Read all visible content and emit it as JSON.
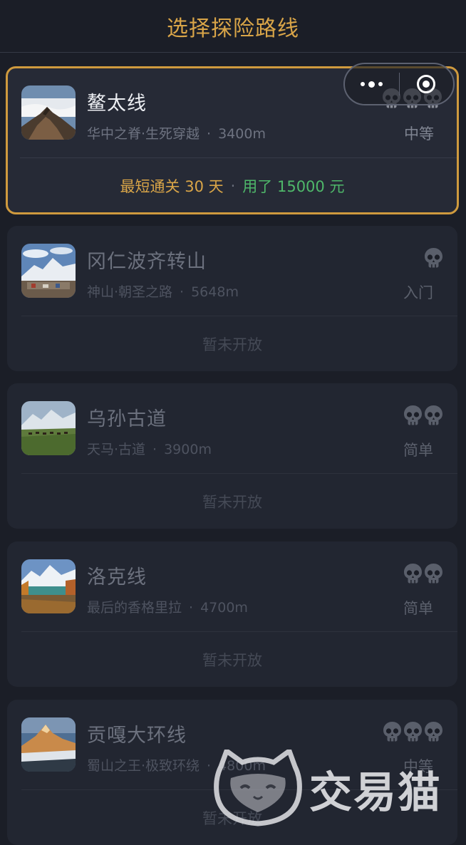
{
  "header": {
    "title": "选择探险路线"
  },
  "capsule": {
    "more_icon": "more-dots-icon",
    "close_icon": "target-circle-icon"
  },
  "routes": [
    {
      "name": "鳌太线",
      "tagline": "华中之脊·生死穿越",
      "altitude": "3400m",
      "difficulty": "中等",
      "skull_count": 3,
      "selected": true,
      "record": {
        "best": "最短通关 30 天",
        "cost": "用了 15000 元"
      },
      "thumb": "mountain-ridge-clouds"
    },
    {
      "name": "冈仁波齐转山",
      "tagline": "神山·朝圣之路",
      "altitude": "5648m",
      "difficulty": "入门",
      "skull_count": 1,
      "status": "暂未开放",
      "thumb": "snow-mountain-village"
    },
    {
      "name": "乌孙古道",
      "tagline": "天马·古道",
      "altitude": "3900m",
      "difficulty": "简单",
      "skull_count": 2,
      "status": "暂未开放",
      "thumb": "grassland-horses"
    },
    {
      "name": "洛克线",
      "tagline": "最后的香格里拉",
      "altitude": "4700m",
      "difficulty": "简单",
      "skull_count": 2,
      "status": "暂未开放",
      "thumb": "lake-autumn-forest"
    },
    {
      "name": "贡嘎大环线",
      "tagline": "蜀山之王·极致环绕",
      "altitude": "4800m",
      "difficulty": "中等",
      "skull_count": 3,
      "status": "暂未开放",
      "thumb": "sunset-peak"
    }
  ],
  "watermark": {
    "text": "交易猫"
  },
  "colors": {
    "accent": "#d9a548",
    "cost": "#4fb86a",
    "background": "#1b1e27"
  }
}
